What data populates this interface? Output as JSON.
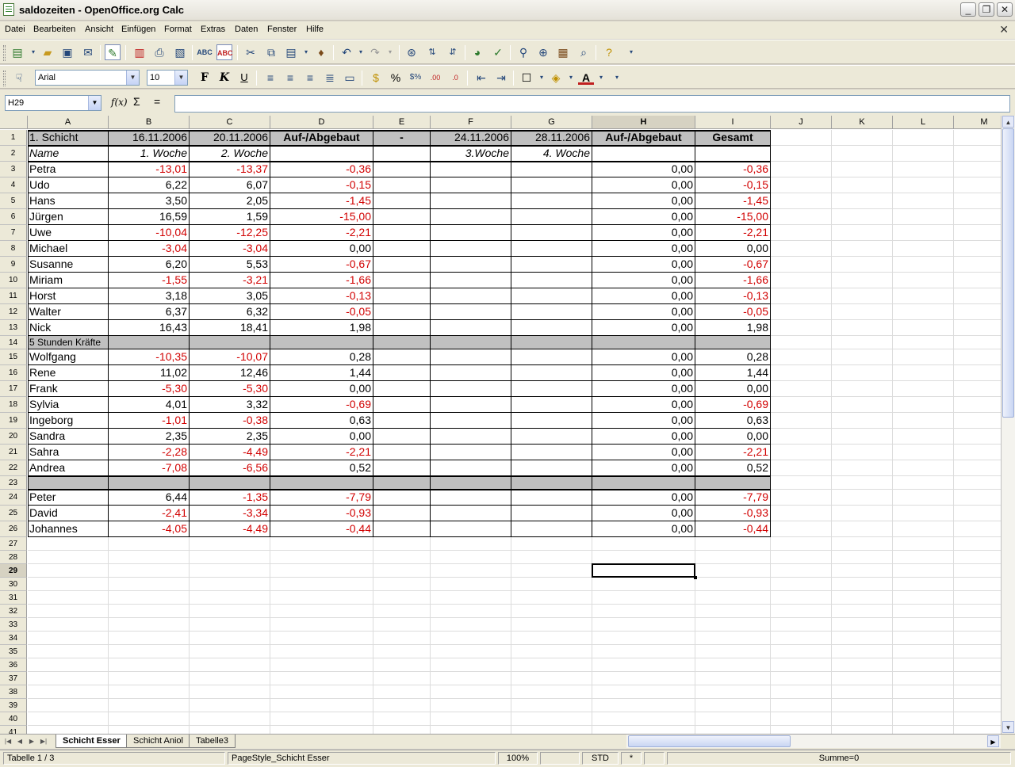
{
  "window": {
    "title": "saldozeiten - OpenOffice.org Calc"
  },
  "menu": [
    "Datei",
    "Bearbeiten",
    "Ansicht",
    "Einfügen",
    "Format",
    "Extras",
    "Daten",
    "Fenster",
    "Hilfe"
  ],
  "format_toolbar": {
    "font_name": "Arial",
    "font_size": "10",
    "bold": "F",
    "italic": "K",
    "underline": "U"
  },
  "formula_bar": {
    "cell_ref": "H29",
    "fx": "f(x)",
    "sum": "Σ",
    "equals": "=",
    "content": ""
  },
  "columns": [
    "A",
    "B",
    "C",
    "D",
    "E",
    "F",
    "G",
    "H",
    "I",
    "J",
    "K",
    "L",
    "M"
  ],
  "row_numbers": [
    "1",
    "2",
    "3",
    "4",
    "5",
    "6",
    "7",
    "8",
    "9",
    "10",
    "11",
    "12",
    "13",
    "14",
    "15",
    "16",
    "17",
    "18",
    "19",
    "20",
    "21",
    "22",
    "23",
    "24",
    "25",
    "26",
    "27",
    "28",
    "29",
    "30",
    "31",
    "32",
    "33",
    "34",
    "35",
    "36",
    "37",
    "38",
    "39",
    "40",
    "41"
  ],
  "header_row": [
    "1. Schicht",
    "16.11.2006",
    "20.11.2006",
    "Auf-/Abgebaut",
    "-",
    "24.11.2006",
    "28.11.2006",
    "Auf-/Abgebaut",
    "Gesamt"
  ],
  "sub_header_row": [
    "Name",
    "1. Woche",
    "2. Woche",
    "",
    "",
    "3.Woche",
    "4. Woche",
    "",
    ""
  ],
  "group_label": "5 Stunden Kräfte",
  "rows": [
    [
      "Petra",
      "-13,01",
      "-13,37",
      "-0,36",
      "0,00",
      "-0,36"
    ],
    [
      "Udo",
      "6,22",
      "6,07",
      "-0,15",
      "0,00",
      "-0,15"
    ],
    [
      "Hans",
      "3,50",
      "2,05",
      "-1,45",
      "0,00",
      "-1,45"
    ],
    [
      "Jürgen",
      "16,59",
      "1,59",
      "-15,00",
      "0,00",
      "-15,00"
    ],
    [
      "Uwe",
      "-10,04",
      "-12,25",
      "-2,21",
      "0,00",
      "-2,21"
    ],
    [
      "Michael",
      "-3,04",
      "-3,04",
      "0,00",
      "0,00",
      "0,00"
    ],
    [
      "Susanne",
      "6,20",
      "5,53",
      "-0,67",
      "0,00",
      "-0,67"
    ],
    [
      "Miriam",
      "-1,55",
      "-3,21",
      "-1,66",
      "0,00",
      "-1,66"
    ],
    [
      "Horst",
      "3,18",
      "3,05",
      "-0,13",
      "0,00",
      "-0,13"
    ],
    [
      "Walter",
      "6,37",
      "6,32",
      "-0,05",
      "0,00",
      "-0,05"
    ],
    [
      "Nick",
      "16,43",
      "18,41",
      "1,98",
      "0,00",
      "1,98"
    ],
    [
      "Wolfgang",
      "-10,35",
      "-10,07",
      "0,28",
      "0,00",
      "0,28"
    ],
    [
      "Rene",
      "11,02",
      "12,46",
      "1,44",
      "0,00",
      "1,44"
    ],
    [
      "Frank",
      "-5,30",
      "-5,30",
      "0,00",
      "0,00",
      "0,00"
    ],
    [
      "Sylvia",
      "4,01",
      "3,32",
      "-0,69",
      "0,00",
      "-0,69"
    ],
    [
      "Ingeborg",
      "-1,01",
      "-0,38",
      "0,63",
      "0,00",
      "0,63"
    ],
    [
      "Sandra",
      "2,35",
      "2,35",
      "0,00",
      "0,00",
      "0,00"
    ],
    [
      "Sahra",
      "-2,28",
      "-4,49",
      "-2,21",
      "0,00",
      "-2,21"
    ],
    [
      "Andrea",
      "-7,08",
      "-6,56",
      "0,52",
      "0,00",
      "0,52"
    ],
    [
      "Peter",
      "6,44",
      "-1,35",
      "-7,79",
      "0,00",
      "-7,79"
    ],
    [
      "David",
      "-2,41",
      "-3,34",
      "-0,93",
      "0,00",
      "-0,93"
    ],
    [
      "Johannes",
      "-4,05",
      "-4,49",
      "-0,44",
      "0,00",
      "-0,44"
    ]
  ],
  "sheet_tabs": [
    "Schicht Esser",
    "Schicht Aniol",
    "Tabelle3"
  ],
  "status": {
    "sheet": "Tabelle 1 / 3",
    "page_style": "PageStyle_Schicht Esser",
    "zoom": "100%",
    "mode": "STD",
    "modified": "*",
    "sum": "Summe=0"
  },
  "colors": {
    "negative": "#d10000",
    "header_bg": "#c0c0c0",
    "selection": "#000000"
  }
}
